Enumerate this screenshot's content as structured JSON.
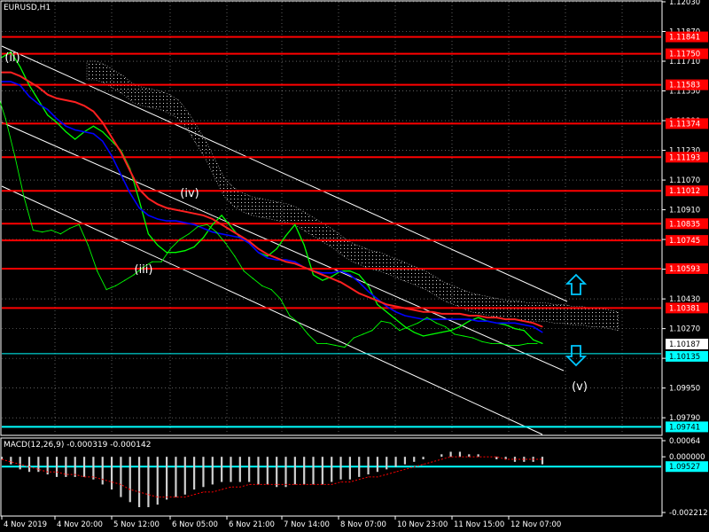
{
  "window": {
    "symbol_label": "EURUSD,H1",
    "macd_label": "MACD(12,26,9) -0.000319 -0.000142"
  },
  "colors": {
    "background": "#000000",
    "grid": "#ffffff",
    "resistance": "#ff0000",
    "support": "#00ffff",
    "price": "#00ff00",
    "ma_fast": "#0000ff",
    "ma_slow": "#ff2020",
    "channel": "#ffffff",
    "arrow": "#00c8ff"
  },
  "chart_data": [
    {
      "type": "line",
      "title": "EURUSD,H1",
      "ylim": [
        1.097,
        1.1203
      ],
      "y_ticks": [
        "1.12030",
        "1.11870",
        "1.11710",
        "1.11550",
        "1.11390",
        "1.11230",
        "1.11070",
        "1.10910",
        "1.10750",
        "1.10590",
        "1.10430",
        "1.10270",
        "1.10110",
        "1.09950",
        "1.09790"
      ],
      "x_ticks": [
        "4 Nov 2019",
        "4 Nov 20:00",
        "5 Nov 12:00",
        "6 Nov 05:00",
        "6 Nov 21:00",
        "7 Nov 14:00",
        "8 Nov 07:00",
        "10 Nov 23:00",
        "11 Nov 15:00",
        "12 Nov 07:00"
      ],
      "resistance_levels": [
        "1.11841",
        "1.11750",
        "1.11583",
        "1.11374",
        "1.11193",
        "1.11012",
        "1.10835",
        "1.10745",
        "1.10593",
        "1.10381"
      ],
      "support_levels": [
        "1.09527",
        "1.09741"
      ],
      "current_price": "1.10187",
      "bid_price": "1.10135",
      "wave_labels": [
        "(ii)",
        "(iii)",
        "(iv)",
        "(v)"
      ],
      "series": [
        {
          "name": "",
          "role": "price",
          "values": [
            1.1173,
            1.1176,
            1.1168,
            1.1158,
            1.115,
            1.1142,
            1.1138,
            1.1133,
            1.1129,
            1.1133,
            1.1136,
            1.1133,
            1.1128,
            1.1123,
            1.1113,
            1.1096,
            1.1078,
            1.1072,
            1.1068,
            1.1068,
            1.1069,
            1.1071,
            1.1076,
            1.1083,
            1.1088,
            1.1082,
            1.1076,
            1.1073,
            1.1068,
            1.1066,
            1.107,
            1.1077,
            1.1083,
            1.1072,
            1.1056,
            1.1053,
            1.1055,
            1.1058,
            1.1058,
            1.1056,
            1.105,
            1.104,
            1.1036,
            1.1032,
            1.1028,
            1.1025,
            1.1023,
            1.1024,
            1.1025,
            1.1026,
            1.1028,
            1.1031,
            1.1033,
            1.1031,
            1.103,
            1.1029,
            1.1027,
            1.1026,
            1.1021,
            1.1019
          ]
        },
        {
          "name": "",
          "role": "ma_fast",
          "values": [
            1.116,
            1.116,
            1.1158,
            1.1152,
            1.1148,
            1.1145,
            1.114,
            1.1136,
            1.1134,
            1.1133,
            1.1132,
            1.1128,
            1.112,
            1.111,
            1.11,
            1.1092,
            1.1088,
            1.1086,
            1.1085,
            1.1085,
            1.1084,
            1.1083,
            1.1081,
            1.1079,
            1.1078,
            1.1077,
            1.1076,
            1.1073,
            1.1068,
            1.1065,
            1.1064,
            1.1064,
            1.1063,
            1.106,
            1.1058,
            1.1057,
            1.1057,
            1.1058,
            1.1056,
            1.1052,
            1.1047,
            1.1043,
            1.1039,
            1.1036,
            1.1034,
            1.1033,
            1.1032,
            1.1032,
            1.1032,
            1.1032,
            1.1032,
            1.1032,
            1.1031,
            1.1031,
            1.103,
            1.103,
            1.103,
            1.1029,
            1.1028,
            1.1025
          ]
        },
        {
          "name": "",
          "role": "ma_slow",
          "values": [
            1.1165,
            1.1165,
            1.1163,
            1.116,
            1.1157,
            1.1153,
            1.1151,
            1.115,
            1.1149,
            1.1147,
            1.1144,
            1.1138,
            1.113,
            1.1122,
            1.1112,
            1.1102,
            1.1097,
            1.1094,
            1.1092,
            1.1091,
            1.109,
            1.1089,
            1.1088,
            1.1086,
            1.1083,
            1.108,
            1.1077,
            1.1074,
            1.107,
            1.1067,
            1.1065,
            1.1063,
            1.1062,
            1.106,
            1.1058,
            1.1056,
            1.1054,
            1.1052,
            1.1049,
            1.1046,
            1.1044,
            1.1042,
            1.104,
            1.1039,
            1.1038,
            1.1037,
            1.1036,
            1.1036,
            1.1035,
            1.1035,
            1.1035,
            1.1034,
            1.1034,
            1.1033,
            1.1033,
            1.1032,
            1.1032,
            1.1031,
            1.103,
            1.1028
          ]
        },
        {
          "name": "",
          "role": "lagging",
          "values": [
            1.1155,
            1.114,
            1.112,
            1.1098,
            1.108,
            1.1079,
            1.108,
            1.1078,
            1.1081,
            1.1083,
            1.1072,
            1.1058,
            1.1048,
            1.105,
            1.1053,
            1.1056,
            1.106,
            1.1063,
            1.1063,
            1.107,
            1.1075,
            1.1078,
            1.1082,
            1.1083,
            1.1079,
            1.1073,
            1.1066,
            1.1058,
            1.1054,
            1.105,
            1.1048,
            1.1043,
            1.1034,
            1.103,
            1.1024,
            1.1019,
            1.1019,
            1.1018,
            1.1017,
            1.1022,
            1.1024,
            1.1026,
            1.1031,
            1.103,
            1.1026,
            1.1028,
            1.103,
            1.1033,
            1.103,
            1.1028,
            1.1024,
            1.1023,
            1.1022,
            1.102,
            1.1019,
            1.1019,
            1.1018,
            1.1018,
            1.1019,
            1.1019
          ]
        }
      ]
    },
    {
      "type": "bar",
      "title": "MACD(12,26,9) -0.000319 -0.000142",
      "ylim": [
        -0.002212,
        0.00064
      ],
      "y_ticks": [
        "0.00064",
        "0.000000",
        "-0.002212"
      ],
      "series": [
        {
          "name": "",
          "role": "histogram",
          "values": [
            -0.0001,
            -0.0003,
            -0.0005,
            -0.0006,
            -0.0006,
            -0.0007,
            -0.0008,
            -0.0008,
            -0.0008,
            -0.0008,
            -0.0009,
            -0.0011,
            -0.0013,
            -0.0016,
            -0.0018,
            -0.002,
            -0.002,
            -0.0019,
            -0.0017,
            -0.0016,
            -0.0015,
            -0.0013,
            -0.0012,
            -0.0011,
            -0.001,
            -0.001,
            -0.001,
            -0.001,
            -0.0011,
            -0.0011,
            -0.0012,
            -0.0012,
            -0.0011,
            -0.0011,
            -0.0011,
            -0.0011,
            -0.001,
            -0.0009,
            -0.0009,
            -0.0008,
            -0.0007,
            -0.0006,
            -0.0005,
            -0.0004,
            -0.0003,
            -0.0002,
            -0.0001,
            0.0,
            0.0001,
            0.0002,
            0.0002,
            0.0001,
            0.0001,
            0.0,
            -0.0001,
            -0.0001,
            -0.0002,
            -0.0002,
            -0.0002,
            -0.0003
          ]
        },
        {
          "name": "",
          "role": "signal",
          "values": [
            -0.0001,
            -0.0002,
            -0.0003,
            -0.0004,
            -0.0005,
            -0.0006,
            -0.0006,
            -0.0007,
            -0.0007,
            -0.0008,
            -0.0008,
            -0.0009,
            -0.001,
            -0.0011,
            -0.0013,
            -0.0014,
            -0.0015,
            -0.0016,
            -0.0016,
            -0.0016,
            -0.0016,
            -0.0015,
            -0.0014,
            -0.0014,
            -0.0013,
            -0.0012,
            -0.0012,
            -0.0011,
            -0.0011,
            -0.0011,
            -0.0011,
            -0.0011,
            -0.0011,
            -0.0011,
            -0.0011,
            -0.0011,
            -0.0011,
            -0.001,
            -0.001,
            -0.0009,
            -0.0008,
            -0.0008,
            -0.0007,
            -0.0006,
            -0.0005,
            -0.0004,
            -0.0003,
            -0.0002,
            -0.0001,
            0.0,
            0.0,
            0.0,
            0.0,
            0.0,
            0.0,
            -0.0001,
            -0.0001,
            -0.0001,
            -0.0001,
            -0.0001
          ]
        }
      ]
    }
  ]
}
